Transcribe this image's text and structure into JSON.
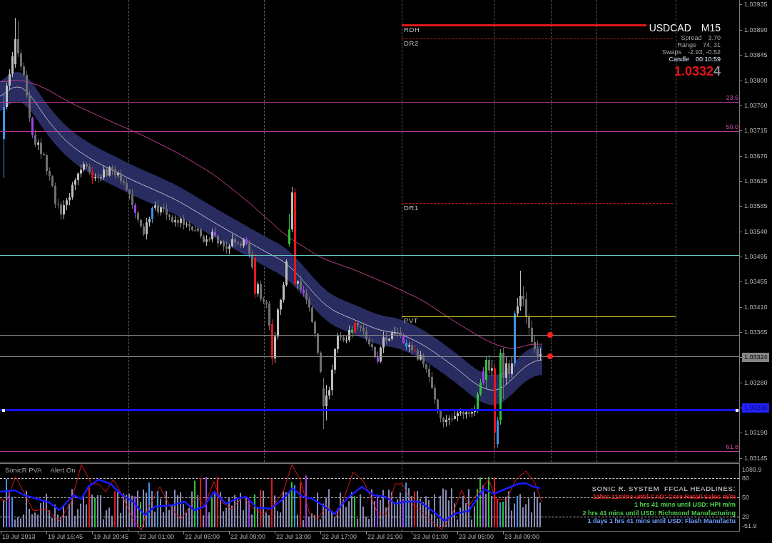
{
  "chart_header": {
    "symbol": "USDCAD",
    "timeframe": "M15",
    "rows": [
      {
        "kind": "info",
        "label": "Spread",
        "value": "3.70"
      },
      {
        "kind": "info",
        "label": "Range",
        "value": "74, 31"
      },
      {
        "kind": "info",
        "label": "Swaps",
        "value": "-2.93, -0.52"
      },
      {
        "kind": "timer",
        "label": "Candle",
        "value": "00:10:59"
      }
    ],
    "bid": {
      "digits": "1.0332",
      "last_digit": "4"
    }
  },
  "levels": [
    {
      "kind": "range_high",
      "label": "RDH"
    },
    {
      "kind": "range",
      "label": "DR2"
    },
    {
      "kind": "range",
      "label": "DR1"
    },
    {
      "kind": "pivot",
      "label": "PVT"
    }
  ],
  "fibonacci_levels": [
    {
      "label": "23.6"
    },
    {
      "label": "50.0"
    },
    {
      "label": "61.8"
    }
  ],
  "price_axis": [
    {
      "kind": "tick",
      "text": "1.03935"
    },
    {
      "kind": "tick",
      "text": "1.03890"
    },
    {
      "kind": "tick",
      "text": "1.03845"
    },
    {
      "kind": "tick",
      "text": "1.03800"
    },
    {
      "kind": "tick",
      "text": "1.03760"
    },
    {
      "kind": "tick",
      "text": "1.03715"
    },
    {
      "kind": "tick",
      "text": "1.03670"
    },
    {
      "kind": "tick",
      "text": "1.03625"
    },
    {
      "kind": "tick",
      "text": "1.03585"
    },
    {
      "kind": "tick",
      "text": "1.03540"
    },
    {
      "kind": "tick",
      "text": "1.03495"
    },
    {
      "kind": "tick",
      "text": "1.03455"
    },
    {
      "kind": "tick",
      "text": "1.03410"
    },
    {
      "kind": "tick",
      "text": "1.03365"
    },
    {
      "kind": "current_price",
      "text": "1.03324"
    },
    {
      "kind": "tick",
      "text": "1.03280"
    },
    {
      "kind": "line_price",
      "text": "1.03230"
    },
    {
      "kind": "tick",
      "text": "1.03190"
    },
    {
      "kind": "tick",
      "text": "1.03145"
    }
  ],
  "indicator": {
    "name": "SonicR PVA",
    "alert": "Alert On",
    "scale": [
      "1089.9",
      "80",
      "50",
      "20",
      "-51.9"
    ],
    "headlines_title": "SONIC R. SYSTEM  FFCAL HEADLINES:",
    "headlines": [
      {
        "text": "11hrs 11mins until CAD: Core Retail Sales m/m",
        "color": "#e8201c"
      },
      {
        "text": "1 hrs 41 mins until USD: HPI m/m",
        "color": "#4fd14f"
      },
      {
        "text": "2 hrs 41 mins until USD: Richmond Manufacturing",
        "color": "#4fd14f"
      },
      {
        "text": "1 days 1 hrs 41 mins until USD: Flash Manufactu",
        "color": "#6f9bff"
      }
    ]
  },
  "time_axis": [
    "19 Jul 2013",
    "19 Jul 16:45",
    "19 Jul 20:45",
    "22 Jul 01:00",
    "22 Jul 05:00",
    "22 Jul 09:00",
    "22 Jul 13:00",
    "22 Jul 17:00",
    "22 Jul 21:00",
    "23 Jul 01:00",
    "23 Jul 05:00",
    "23 Jul 09:00"
  ]
}
